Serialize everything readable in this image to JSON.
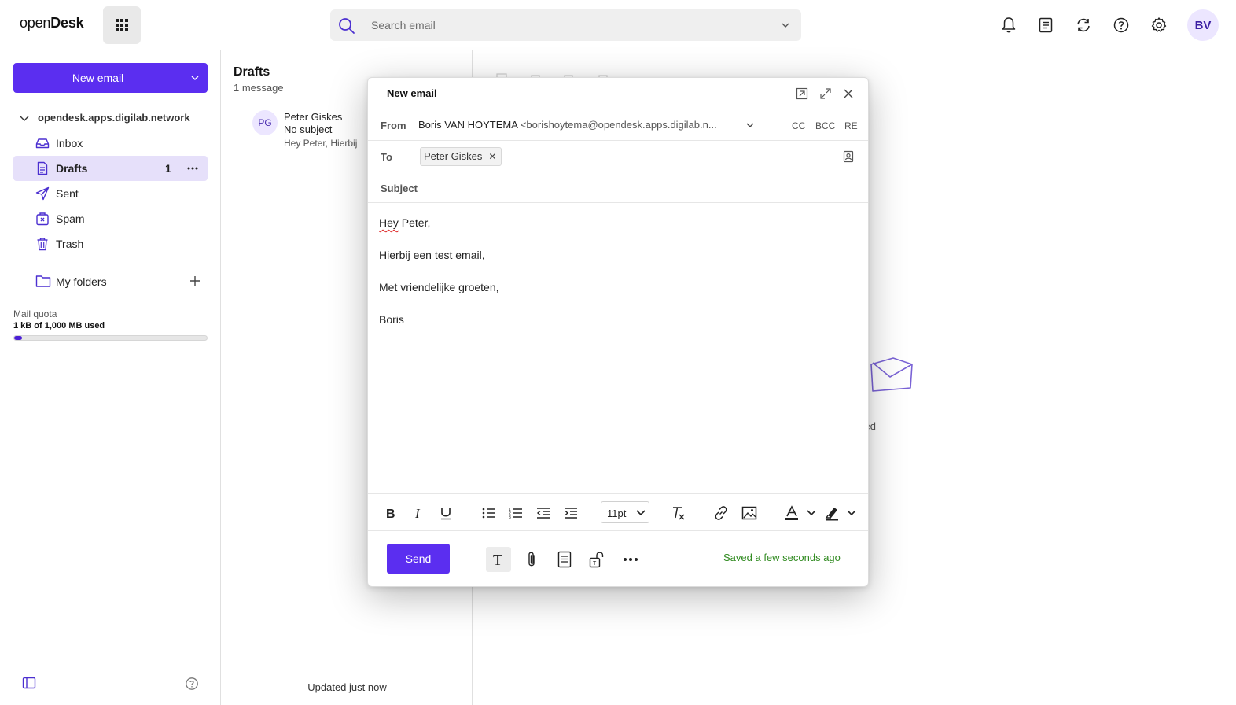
{
  "topbar": {
    "logo_open": "open",
    "logo_desk": "Desk",
    "search_placeholder": "Search email",
    "avatar_initials": "BV",
    "icons": [
      "apps-grid-icon",
      "search-icon",
      "bell-icon",
      "tasks-icon",
      "sync-icon",
      "help-icon",
      "gear-icon"
    ]
  },
  "sidebar": {
    "new_email_label": "New email",
    "account": "opendesk.apps.digilab.network",
    "items": [
      {
        "label": "Inbox",
        "icon": "inbox-icon"
      },
      {
        "label": "Drafts",
        "icon": "drafts-icon",
        "count": "1",
        "active": true
      },
      {
        "label": "Sent",
        "icon": "sent-icon"
      },
      {
        "label": "Spam",
        "icon": "spam-icon"
      },
      {
        "label": "Trash",
        "icon": "trash-icon"
      }
    ],
    "my_folders_label": "My folders",
    "quota": {
      "label": "Mail quota",
      "used_text": "1 kB of 1,000 MB used",
      "fill_fraction": 0.04
    }
  },
  "list": {
    "title": "Drafts",
    "count_text": "1 message",
    "message": {
      "avatar": "PG",
      "sender": "Peter Giskes",
      "subject": "No subject",
      "preview": "Hey Peter,   Hierbij"
    },
    "updated_text": "Updated just now"
  },
  "reading": {
    "empty_text": "elected"
  },
  "compose": {
    "title": "New email",
    "from_label": "From",
    "from_name": "Boris VAN HOYTEMA",
    "from_address": "<borishoytema@opendesk.apps.digilab.n...",
    "cc_label": "CC",
    "bcc_label": "BCC",
    "re_label": "RE",
    "to_label": "To",
    "to_recipient": "Peter Giskes",
    "subject_label": "Subject",
    "subject_value": "",
    "body": {
      "greeting_word": "Hey",
      "greeting_rest": " Peter,",
      "line2": "Hierbij een test email,",
      "line3": "Met vriendelijke groeten,",
      "line4": "Boris"
    },
    "font_size": "11pt",
    "send_label": "Send",
    "saved_text": "Saved a few seconds ago",
    "accent_color": "#5b2ef0",
    "saved_color": "#2f8a1f"
  }
}
